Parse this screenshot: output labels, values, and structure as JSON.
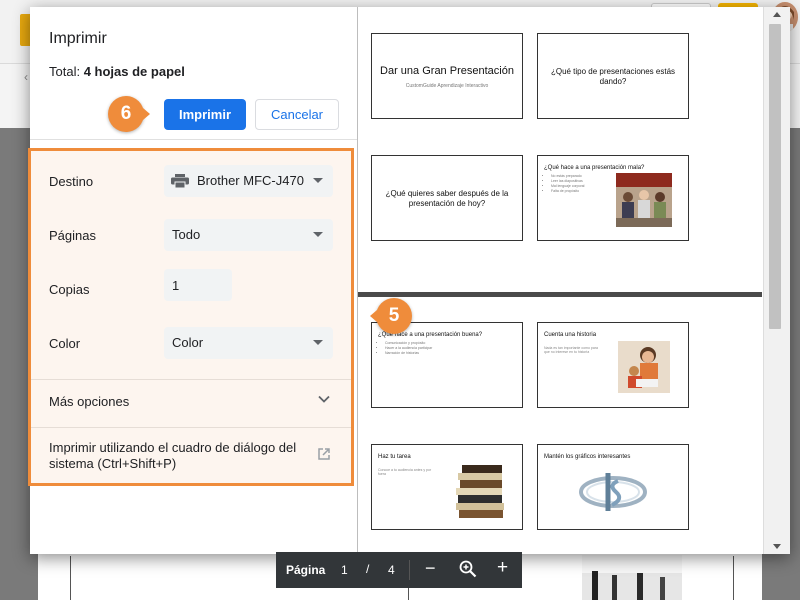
{
  "dialog": {
    "title": "Imprimir",
    "total_label": "Total:",
    "total_value": "4 hojas de papel",
    "print_button": "Imprimir",
    "cancel_button": "Cancelar"
  },
  "settings": {
    "destination": {
      "label": "Destino",
      "value": "Brother MFC-J470"
    },
    "pages": {
      "label": "Páginas",
      "value": "Todo"
    },
    "copies": {
      "label": "Copias",
      "value": "1"
    },
    "color": {
      "label": "Color",
      "value": "Color"
    },
    "more_options": "Más opciones",
    "system_dialog": "Imprimir utilizando el cuadro de diálogo del sistema (Ctrl+Shift+P)"
  },
  "callouts": {
    "step_print": "6",
    "step_settings": "5"
  },
  "preview": {
    "sheet1": [
      {
        "title": "Dar una Gran Presentación",
        "subtitle": "CustomGuide Aprendizaje Interactivo"
      },
      {
        "title": "¿Qué tipo de presentaciones estás dando?"
      },
      {
        "title": "¿Qué quieres saber después de la presentación de hoy?"
      },
      {
        "title": "¿Qué hace a una presentación mala?",
        "bullets": [
          "No estás preparado",
          "Leer las diapositivas",
          "Mal lenguaje corporal",
          "Falta de propósito"
        ]
      }
    ],
    "sheet2": [
      {
        "title": "¿Qué hace a una presentación buena?",
        "bullets": [
          "Comunicación y propósito",
          "Hacer a la audiencia participar",
          "Narración de historias"
        ]
      },
      {
        "title": "Cuenta una historia",
        "subtitle": "Nada es tan importante como para que no interese en tu historia"
      },
      {
        "title": "Haz tu tarea",
        "subtitle": "Conoce a tu audiencia antes y por fuera"
      },
      {
        "title": "Mantén los gráficos interesantes"
      }
    ]
  },
  "pager": {
    "label": "Página",
    "current": "1",
    "separator": "/",
    "total": "4"
  },
  "colors": {
    "accent": "#1a73e8",
    "callout": "#ef8c3b",
    "toolbar": "#323639"
  },
  "icons": [
    "printer-icon",
    "caret-down-icon",
    "chevron-down-icon",
    "external-link-icon",
    "zoom-in-icon",
    "minus-icon",
    "plus-icon"
  ]
}
